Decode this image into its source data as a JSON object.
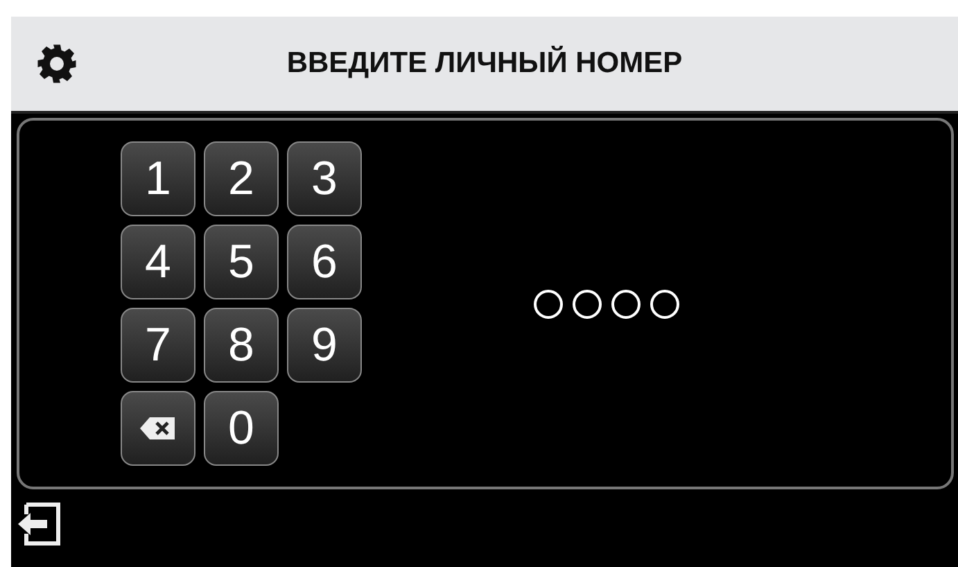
{
  "header": {
    "title": "ВВЕДИТЕ ЛИЧНЫЙ НОМЕР"
  },
  "keypad": [
    {
      "kind": "digit",
      "label": "1"
    },
    {
      "kind": "digit",
      "label": "2"
    },
    {
      "kind": "digit",
      "label": "3"
    },
    {
      "kind": "digit",
      "label": "4"
    },
    {
      "kind": "digit",
      "label": "5"
    },
    {
      "kind": "digit",
      "label": "6"
    },
    {
      "kind": "digit",
      "label": "7"
    },
    {
      "kind": "digit",
      "label": "8"
    },
    {
      "kind": "digit",
      "label": "9"
    },
    {
      "kind": "backspace"
    },
    {
      "kind": "digit",
      "label": "0"
    }
  ],
  "pin_dots": [
    {
      "filled": false
    },
    {
      "filled": false
    },
    {
      "filled": false
    },
    {
      "filled": false
    }
  ]
}
